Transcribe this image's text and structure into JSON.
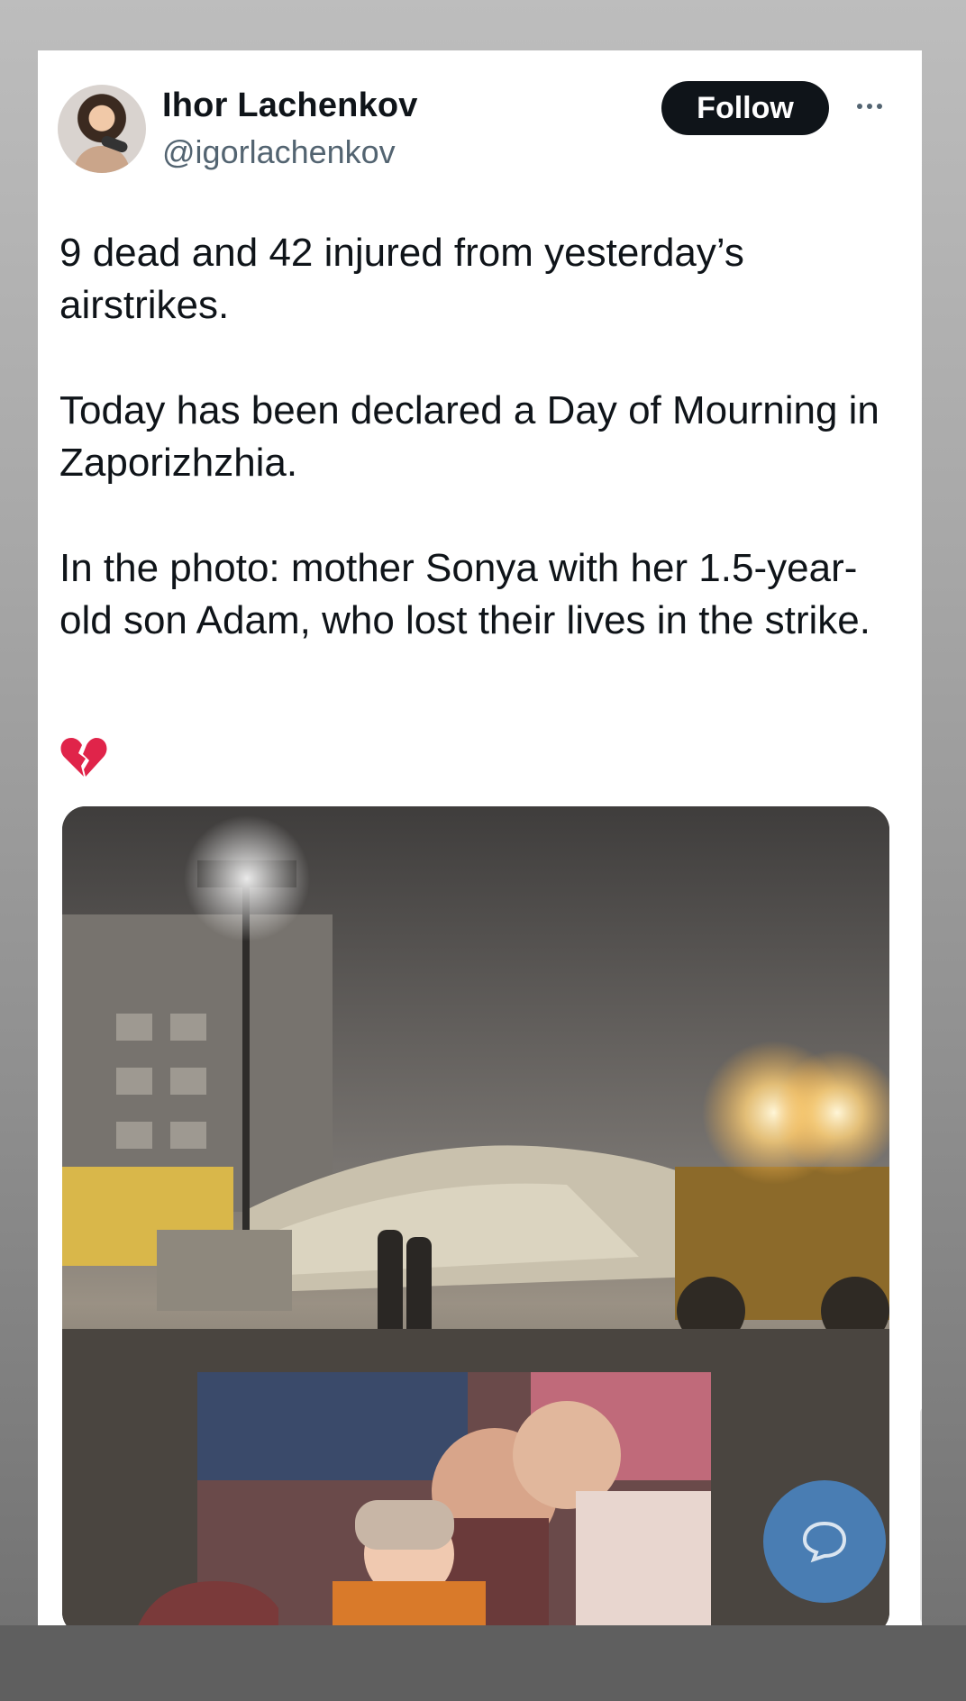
{
  "author": {
    "name": "Ihor Lachenkov",
    "handle": "@igorlachenkov"
  },
  "actions": {
    "follow_label": "Follow"
  },
  "tweet": {
    "paragraph_1": "9 dead and 42 injured from yesterday’s airstrikes.",
    "paragraph_2": "Today has been declared a Day of Mourning in Zaporizhzhia.",
    "paragraph_3": "In the photo: mother Sonya with her 1.5-year-old son Adam, who lost their lives in the strike.",
    "emoji_icon": "broken-heart-icon"
  },
  "colors": {
    "follow_bg": "#0f1419",
    "handle": "#536471",
    "text": "#0f1419",
    "broken_heart": "#e0244a",
    "chat_bubble": "#4a90d9"
  }
}
